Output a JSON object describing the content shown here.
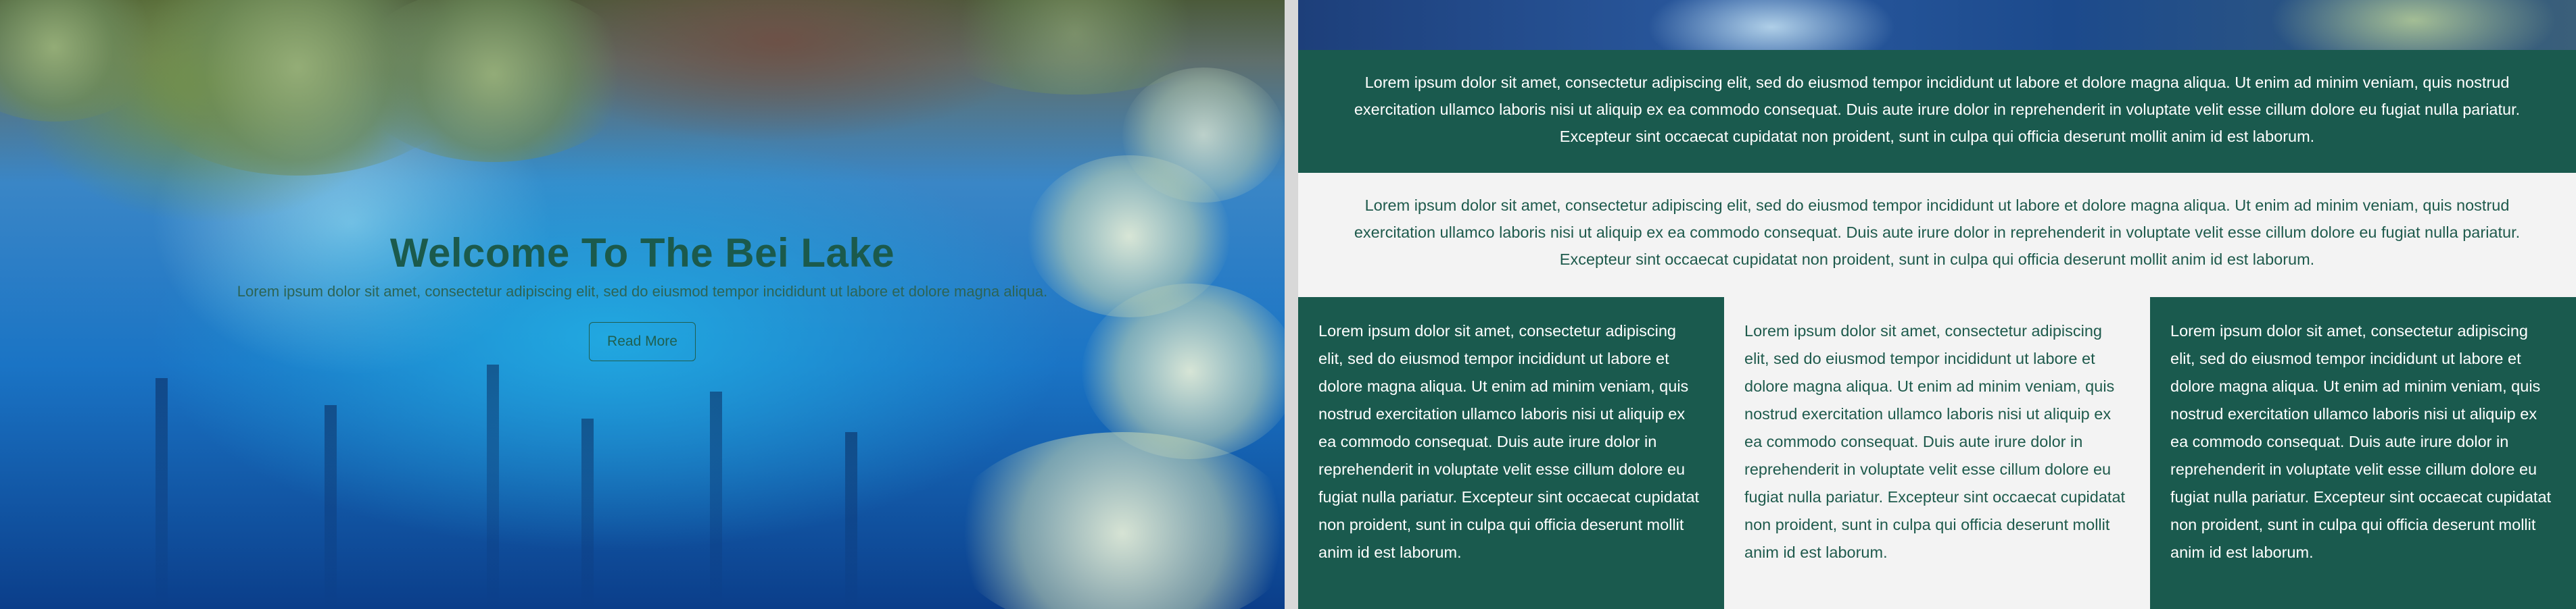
{
  "hero": {
    "title": "Welcome To The Bei Lake",
    "subtitle": "Lorem ipsum dolor sit amet, consectetur adipiscing elit, sed do eiusmod tempor incididunt ut labore et dolore magna aliqua.",
    "button_label": "Read More"
  },
  "sections": {
    "band_dark_text": "Lorem ipsum dolor sit amet, consectetur adipiscing elit, sed do eiusmod tempor incididunt ut labore et dolore magna aliqua. Ut enim ad minim veniam, quis nostrud exercitation ullamco laboris nisi ut aliquip ex ea commodo consequat. Duis aute irure dolor in reprehenderit in voluptate velit esse cillum dolore eu fugiat nulla pariatur. Excepteur sint occaecat cupidatat non proident, sunt in culpa qui officia deserunt mollit anim id est laborum.",
    "band_light_text": "Lorem ipsum dolor sit amet, consectetur adipiscing elit, sed do eiusmod tempor incididunt ut labore et dolore magna aliqua. Ut enim ad minim veniam, quis nostrud exercitation ullamco laboris nisi ut aliquip ex ea commodo consequat. Duis aute irure dolor in reprehenderit in voluptate velit esse cillum dolore eu fugiat nulla pariatur. Excepteur sint occaecat cupidatat non proident, sunt in culpa qui officia deserunt mollit anim id est laborum.",
    "columns": [
      {
        "text": "Lorem ipsum dolor sit amet, consectetur adipiscing elit, sed do eiusmod tempor incididunt ut labore et dolore magna aliqua. Ut enim ad minim veniam, quis nostrud exercitation ullamco laboris nisi ut aliquip ex ea commodo consequat. Duis aute irure dolor in reprehenderit in voluptate velit esse cillum dolore eu fugiat nulla pariatur. Excepteur sint occaecat cupidatat non proident, sunt in culpa qui officia deserunt mollit anim id est laborum."
      },
      {
        "text": "Lorem ipsum dolor sit amet, consectetur adipiscing elit, sed do eiusmod tempor incididunt ut labore et dolore magna aliqua. Ut enim ad minim veniam, quis nostrud exercitation ullamco laboris nisi ut aliquip ex ea commodo consequat. Duis aute irure dolor in reprehenderit in voluptate velit esse cillum dolore eu fugiat nulla pariatur. Excepteur sint occaecat cupidatat non proident, sunt in culpa qui officia deserunt mollit anim id est laborum."
      },
      {
        "text": "Lorem ipsum dolor sit amet, consectetur adipiscing elit, sed do eiusmod tempor incididunt ut labore et dolore magna aliqua. Ut enim ad minim veniam, quis nostrud exercitation ullamco laboris nisi ut aliquip ex ea commodo consequat. Duis aute irure dolor in reprehenderit in voluptate velit esse cillum dolore eu fugiat nulla pariatur. Excepteur sint occaecat cupidatat non proident, sunt in culpa qui officia deserunt mollit anim id est laborum."
      }
    ]
  },
  "colors": {
    "brand_green": "#1a5a4e",
    "light_background": "#f3f3f3",
    "lake_blue": "#21a8e0"
  }
}
